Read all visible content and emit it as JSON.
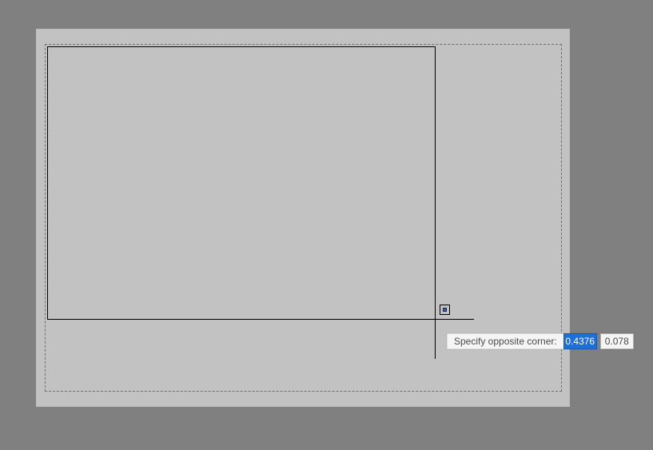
{
  "prompt": {
    "label": "Specify opposite corner:",
    "x_value": "0.4376",
    "y_value": "0.078"
  }
}
